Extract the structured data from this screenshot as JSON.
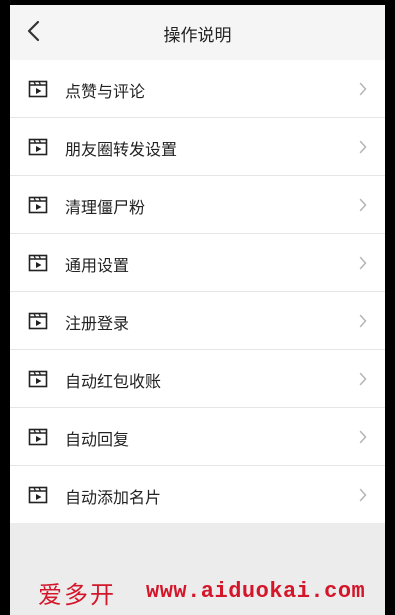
{
  "header": {
    "title": "操作说明",
    "back_icon": "chevron-left-icon"
  },
  "menu": {
    "item_icon": "video-clapper-icon",
    "chevron_icon": "chevron-right-icon",
    "items": [
      {
        "label": "点赞与评论"
      },
      {
        "label": "朋友圈转发设置"
      },
      {
        "label": "清理僵尸粉"
      },
      {
        "label": "通用设置"
      },
      {
        "label": "注册登录"
      },
      {
        "label": "自动红包收账"
      },
      {
        "label": "自动回复"
      },
      {
        "label": "自动添加名片"
      }
    ]
  },
  "watermark": {
    "brand": "爱多开",
    "url": "www.aiduokai.com",
    "color": "#d3162a"
  },
  "colors": {
    "background": "#ececec",
    "header_bg": "#f5f5f5",
    "list_bg": "#ffffff",
    "text": "#222222",
    "divider": "#e6e6e6"
  }
}
